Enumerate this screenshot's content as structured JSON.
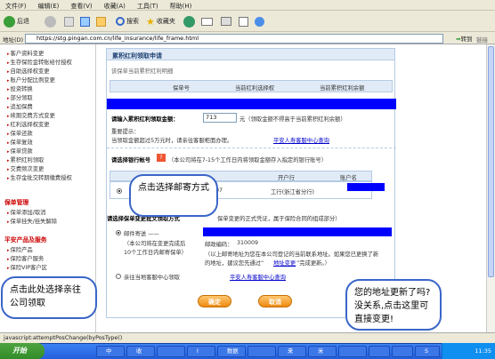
{
  "menu": [
    "文件(F)",
    "编辑(E)",
    "查看(V)",
    "收藏(A)",
    "工具(T)",
    "帮助(H)"
  ],
  "toolbar": {
    "back": "后退",
    "search": "搜索",
    "favorites": "收藏夹"
  },
  "address": {
    "label": "地址(D)",
    "url": "https://stg.pingan.com.cn/life_insurance/life_frame.html",
    "go": "转到",
    "links": "链接"
  },
  "sidebar": {
    "items1": [
      "客户资料变更",
      "生存保险金转账给付授权",
      "自助选择权变更",
      "账户分配比例变更",
      "投资转换",
      "部分领取",
      "追加保费",
      "续期交费方式变更",
      "红利选择权变更",
      "保单还款",
      "保单复效",
      "保单贷款",
      "累积红利领取",
      "交费频次变更",
      "生存金批交转期缴费授权"
    ],
    "head2": "保单管理",
    "items2": [
      "保单添加/取消",
      "保单挂失/挂失解除"
    ],
    "head3": "平安产品及服务",
    "items3": [
      "保险产品",
      "保险客户服务",
      "保险VIP客户区"
    ]
  },
  "panel": {
    "title": "累积红利领取申请",
    "subtitle": "该保单当前累积红利明细",
    "col1": "保单号",
    "col2": "当前红利选择权",
    "col3": "当前累积红利余额",
    "amount_label": "请输入累积红利领取金额：",
    "amount_value": "713",
    "amount_note": "元（领取金额不得高于当前累积红利余额）",
    "tips_label": "重要提示：",
    "tips_text": "当领取金额超过5万元时，请亲往客服柜面办理。",
    "tips_link": "平安人寿客服中心查询",
    "bank_label": "请选择银行帐号",
    "bank_note": "（本公司将在7-15个工作日内将领取金额存入指定的银行账号）",
    "bank_col_bank": "开户行",
    "bank_col_name": "账户名",
    "bank_row_partial": "3107",
    "bank_row_branch": "工行(浙江省分行)",
    "method_label": "请选择保单变更批文领取方式",
    "method_note": "保单变更的正式凭证，属于保险合同的组成部分）",
    "mail_label": "邮件寄送 ——",
    "mail_note1": "（本公司将在变更完成后",
    "mail_note2": "10个工作日内邮寄保单）",
    "zip_label": "邮政编码：",
    "zip_value": "310009",
    "addr_note1": "（以上邮寄地址为您在本公司登记的当前联系地址。如果您已更换了新",
    "addr_note2": "的地址，建议您先通过“",
    "addr_link": "地址变更",
    "addr_note3": "”完成更新。）",
    "pickup_label": "亲往当地客服中心领取",
    "pickup_link": "平安人寿客服中心查询",
    "ok": "确定",
    "cancel": "取消"
  },
  "bubbles": {
    "b1": "点击选择邮寄方式",
    "b2": "点击此处选择亲往公司领取",
    "b3": "您的地址更新了吗?没关系,点击这里可直接变更!"
  },
  "status": "javascript:attemptPosChange(byPosType()",
  "taskbar": {
    "start": "开始",
    "tasks": [
      "中",
      "收",
      "",
      "I",
      "数据",
      "",
      "来",
      "米",
      "",
      "",
      "",
      "S"
    ],
    "time": "11:35"
  }
}
